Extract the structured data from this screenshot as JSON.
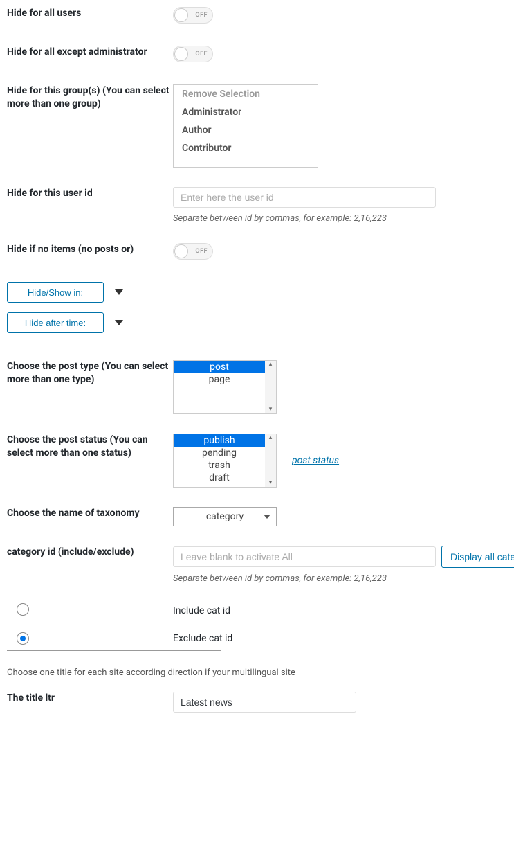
{
  "toggles": {
    "hide_all_users": {
      "label": "Hide for all users",
      "state": "OFF"
    },
    "hide_except_admin": {
      "label": "Hide for all except administrator",
      "state": "OFF"
    },
    "hide_no_items": {
      "label": "Hide if no items (no posts or)",
      "state": "OFF"
    }
  },
  "groups": {
    "label": "Hide for this group(s) (You can select more than one group)",
    "options": [
      "Remove Selection",
      "Administrator",
      "Author",
      "Contributor"
    ]
  },
  "user_id": {
    "label": "Hide for this user id",
    "placeholder": "Enter here the user id",
    "help": "Separate between id by commas, for example: 2,16,223"
  },
  "accordions": {
    "hide_show": "Hide/Show in:",
    "hide_after": "Hide after time:"
  },
  "post_type": {
    "label": "Choose the post type (You can select more than one type)",
    "options": [
      "post",
      "page"
    ],
    "selected": [
      "post"
    ]
  },
  "post_status": {
    "label": "Choose the post status (You can select more than one status)",
    "options": [
      "publish",
      "pending",
      "trash",
      "draft"
    ],
    "selected": [
      "publish"
    ],
    "link": "post status"
  },
  "taxonomy": {
    "label": "Choose the name of taxonomy",
    "value": "category"
  },
  "category_id": {
    "label": "category id (include/exclude)",
    "placeholder": "Leave blank to activate All",
    "help": "Separate between id by commas, for example: 2,16,223",
    "button": "Display all cate"
  },
  "radios": {
    "include": "Include cat id",
    "exclude": "Exclude cat id",
    "selected": "exclude"
  },
  "multilingual_note": "Choose one title for each site according direction if your multilingual site",
  "title_ltr": {
    "label": "The title ltr",
    "value": "Latest news"
  }
}
